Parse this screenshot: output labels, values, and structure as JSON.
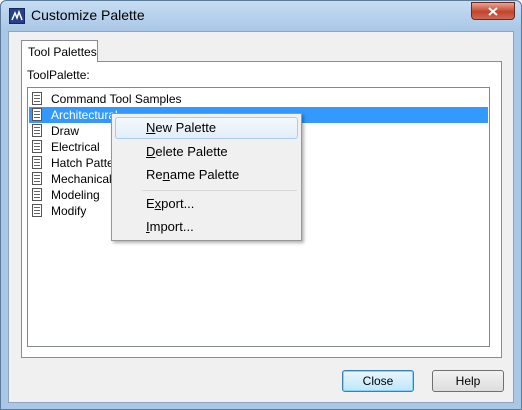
{
  "window": {
    "title": "Customize Palette"
  },
  "tabs": [
    {
      "label": "Tool Palettes"
    }
  ],
  "panel": {
    "label": "ToolPalette:"
  },
  "list": {
    "items": [
      {
        "label": "Command Tool Samples"
      },
      {
        "label": "Architectural",
        "selected": true
      },
      {
        "label": "Draw"
      },
      {
        "label": "Electrical"
      },
      {
        "label": "Hatch Patterns"
      },
      {
        "label": "Mechanical"
      },
      {
        "label": "Modeling"
      },
      {
        "label": "Modify"
      }
    ]
  },
  "context_menu": {
    "items": [
      {
        "pre": "",
        "key": "N",
        "post": "ew Palette",
        "hover": true
      },
      {
        "pre": "",
        "key": "D",
        "post": "elete Palette"
      },
      {
        "pre": "Re",
        "key": "n",
        "post": "ame Palette"
      },
      {
        "pre": "E",
        "key": "x",
        "post": "port..."
      },
      {
        "pre": "",
        "key": "I",
        "post": "mport..."
      }
    ]
  },
  "buttons": {
    "close": "Close",
    "help": "Help"
  }
}
